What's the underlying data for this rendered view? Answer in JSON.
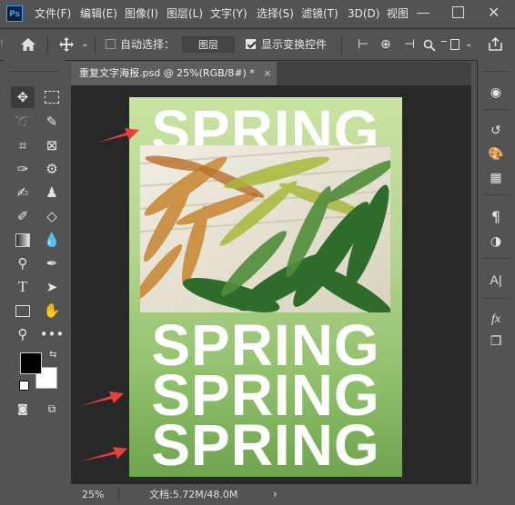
{
  "menubar": {
    "items": [
      "文件(F)",
      "编辑(E)",
      "图像(I)",
      "图层(L)",
      "文字(Y)",
      "选择(S)",
      "滤镜(T)",
      "3D(D)",
      "视图"
    ]
  },
  "options": {
    "auto_select_label": "自动选择：",
    "layer_dropdown": "图层",
    "show_transform_label": "显示变换控件"
  },
  "document": {
    "tab_title": "重复文字海报.psd @ 25%(RGB/8#) *",
    "close_glyph": "×",
    "poster_text": "SPRING"
  },
  "status": {
    "zoom": "25%",
    "doc_info": "文档:5.72M/48.0M",
    "arrow": "›"
  },
  "colors": {
    "annotation_arrow": "#e8403a",
    "poster_green": "#9cc877"
  }
}
